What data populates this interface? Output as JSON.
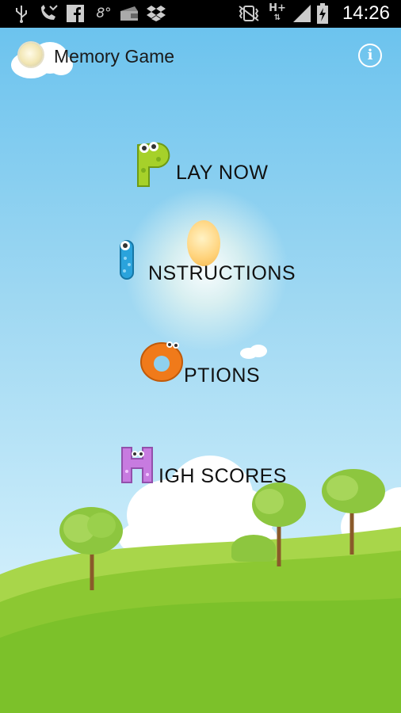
{
  "status_bar": {
    "time": "14:26",
    "network": "H+",
    "icons": [
      "usb-icon",
      "missed-call-icon",
      "facebook-icon",
      "temperature-icon",
      "wallet-icon",
      "dropbox-icon",
      "vibrate-icon",
      "signal-icon",
      "battery-charging-icon"
    ],
    "temperature": "8°"
  },
  "header": {
    "title": "Memory Game",
    "info_label": "i"
  },
  "menu": {
    "play_now": {
      "letter": "P",
      "label": "LAY NOW"
    },
    "instructions": {
      "letter": "I",
      "label": "NSTRUCTIONS"
    },
    "options": {
      "letter": "O",
      "label": "PTIONS"
    },
    "high_scores": {
      "letter": "H",
      "label": "IGH SCORES"
    }
  },
  "colors": {
    "sky_top": "#6cc3ee",
    "grass": "#7cc12a",
    "letter_p": "#a6d12a",
    "letter_i": "#2aa3dc",
    "letter_o": "#f07a1a",
    "letter_h": "#c77be0"
  }
}
